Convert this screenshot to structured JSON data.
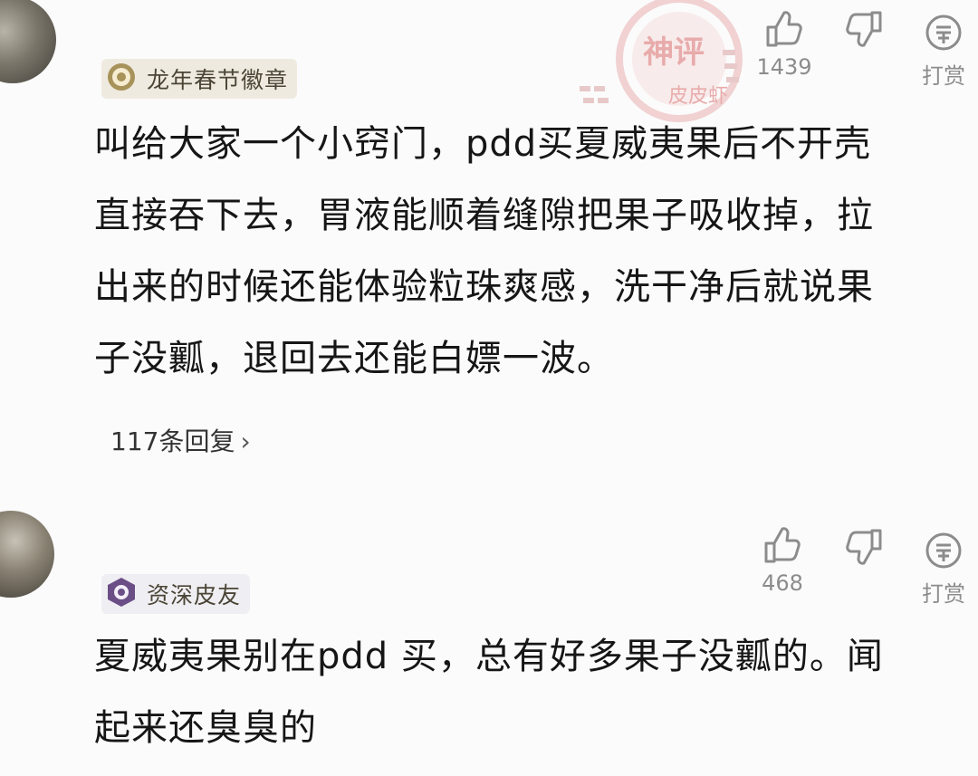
{
  "comments": [
    {
      "badge_label": "龙年春节徽章",
      "like_count": "1439",
      "reward_label": "打赏",
      "body_lines": [
        "叫给大家一个小窍门，pdd买夏威夷果后不开壳",
        "直接吞下去，胃液能顺着缝隙把果子吸收掉，拉",
        "出来的时候还能体验粒珠爽感，洗干净后就说果",
        "子没瓤，退回去还能白嫖一波。"
      ],
      "replies_label": "117条回复"
    },
    {
      "badge_label": "资深皮友",
      "like_count": "468",
      "reward_label": "打赏",
      "body_lines": [
        "夏威夷果别在pdd 买，总有好多果子没瓤的。闻",
        "起来还臭臭的"
      ]
    }
  ],
  "watermark": {
    "stamp_text": "神评",
    "brand_text": "皮皮虾"
  },
  "icons": {
    "like": "thumbs-up-icon",
    "dislike": "thumbs-down-icon",
    "reward": "reward-coin-icon",
    "chevron": "chevron-right-icon"
  },
  "colors": {
    "badge_bg": "#efeadf",
    "badge_text": "#4b4536",
    "icon_gray": "#8c8c8c",
    "watermark_red": "#d96a6a"
  }
}
